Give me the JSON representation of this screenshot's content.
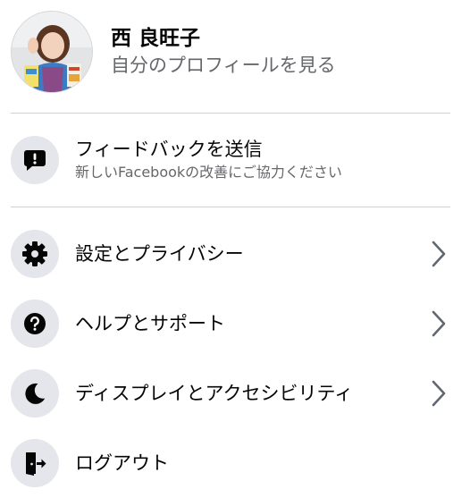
{
  "profile": {
    "name": "西 良旺子",
    "subtitle": "自分のプロフィールを見る"
  },
  "feedback": {
    "label": "フィードバックを送信",
    "sublabel": "新しいFacebookの改善にご協力ください",
    "icon": "feedback-exclamation-icon"
  },
  "menu_items": [
    {
      "label": "設定とプライバシー",
      "icon": "gear-icon",
      "has_chevron": true
    },
    {
      "label": "ヘルプとサポート",
      "icon": "question-icon",
      "has_chevron": true
    },
    {
      "label": "ディスプレイとアクセシビリティ",
      "icon": "moon-icon",
      "has_chevron": true
    },
    {
      "label": "ログアウト",
      "icon": "logout-door-icon",
      "has_chevron": false
    }
  ],
  "colors": {
    "icon_background": "#e4e6eb",
    "icon_glyph": "#050505",
    "secondary_text": "#65676b",
    "divider": "#ced0d4"
  }
}
